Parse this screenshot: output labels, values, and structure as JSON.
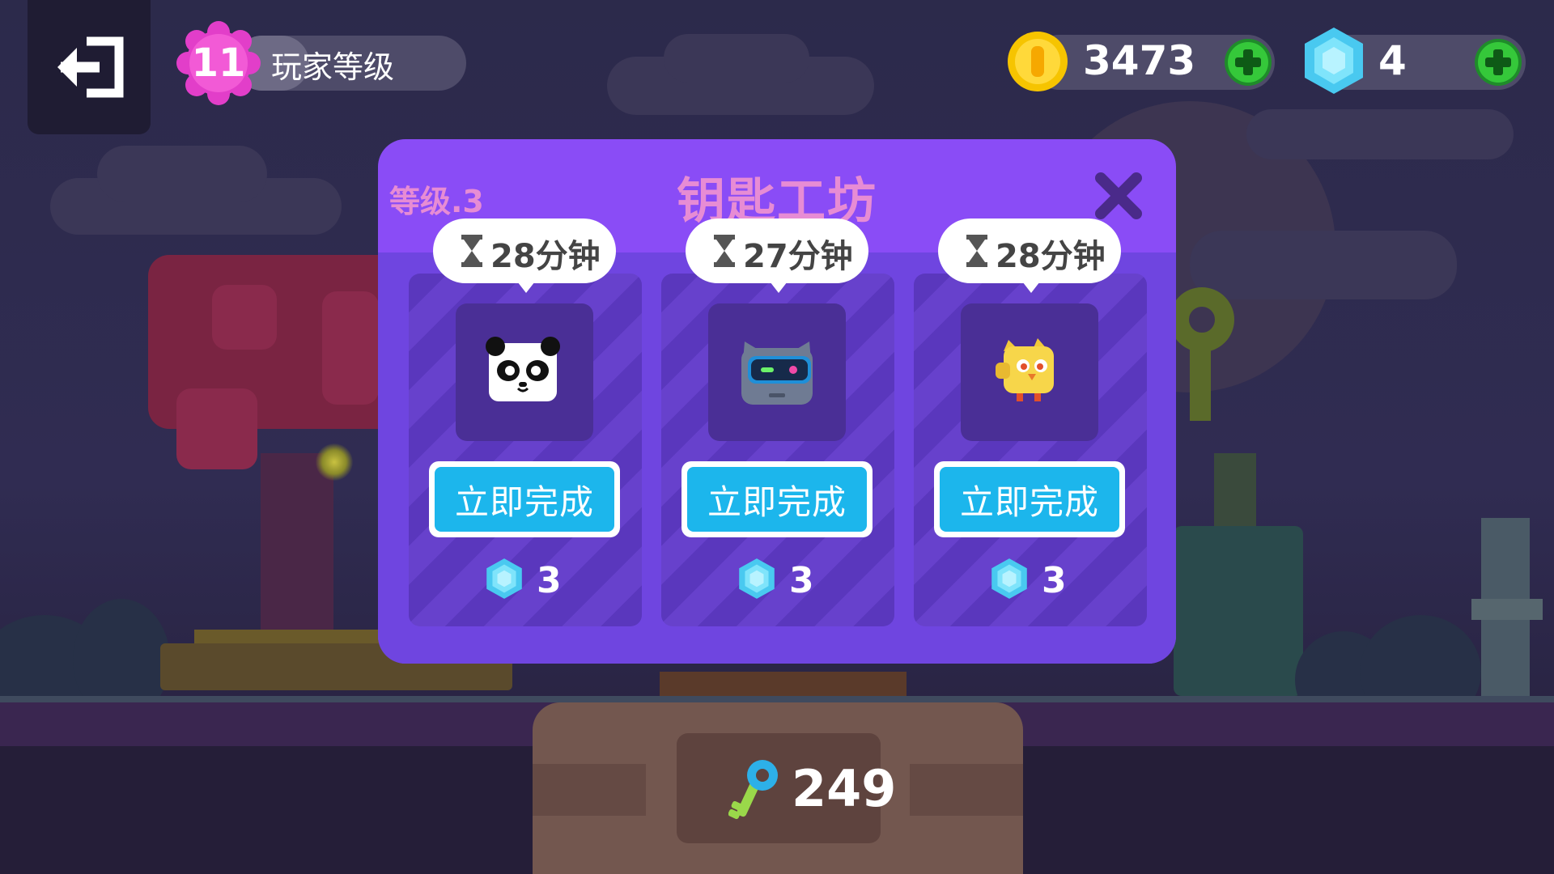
{
  "hud": {
    "player_level": "11",
    "player_level_label": "玩家等级",
    "coins": "3473",
    "gems": "4"
  },
  "modal": {
    "level_label": "等级.3",
    "title": "钥匙工坊",
    "cards": [
      {
        "timer": "28分钟",
        "character": "panda-icon",
        "button_label": "立即完成",
        "cost": "3"
      },
      {
        "timer": "27分钟",
        "character": "robot-cat-icon",
        "button_label": "立即完成",
        "cost": "3"
      },
      {
        "timer": "28分钟",
        "character": "yellow-chick-icon",
        "button_label": "立即完成",
        "cost": "3"
      }
    ]
  },
  "footer": {
    "keys": "249"
  },
  "colors": {
    "modal_bg": "#8a4cf6",
    "modal_body": "#6f45e0",
    "title_pink": "#e78cd4",
    "button_blue": "#1cb6ec",
    "coin_gold": "#f6c400",
    "gem_cyan": "#5fd8f5",
    "plus_green": "#35c83a",
    "level_badge_pink": "#e23ec9"
  }
}
